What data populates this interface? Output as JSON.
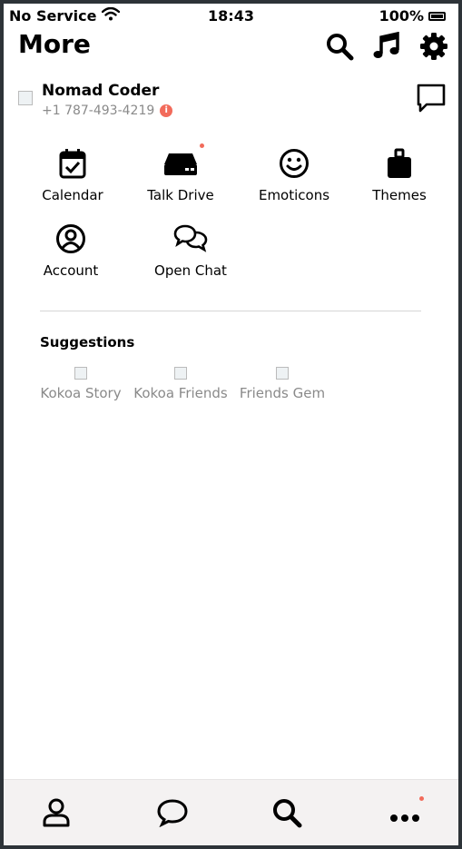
{
  "status_bar": {
    "carrier": "No Service",
    "time": "18:43",
    "battery": "100%"
  },
  "header": {
    "title": "More",
    "icons": [
      "search-icon",
      "music-note-icon",
      "gear-icon"
    ]
  },
  "profile": {
    "name": "Nomad Coder",
    "phone": "+1 787-493-4219",
    "info_badge": "i"
  },
  "menu_items": [
    {
      "label": "Calendar",
      "icon": "calendar-icon"
    },
    {
      "label": "Talk Drive",
      "icon": "drive-icon",
      "has_dot": true
    },
    {
      "label": "Emoticons",
      "icon": "smiley-icon"
    },
    {
      "label": "Themes",
      "icon": "theme-bag-icon"
    },
    {
      "label": "Account",
      "icon": "account-icon"
    },
    {
      "label": "Open Chat",
      "icon": "open-chat-icon"
    }
  ],
  "suggestions": {
    "title": "Suggestions",
    "items": [
      {
        "label": "Kokoa Story"
      },
      {
        "label": "Kokoa Friends"
      },
      {
        "label": "Friends Gem"
      }
    ]
  },
  "tab_bar": {
    "tabs": [
      "person-icon",
      "chat-bubble-icon",
      "search-icon",
      "more-dots-icon"
    ]
  },
  "colors": {
    "accent_dot": "#f26b5b",
    "muted_text": "#8a8a8a",
    "tab_bar_bg": "#f4f2f2"
  }
}
